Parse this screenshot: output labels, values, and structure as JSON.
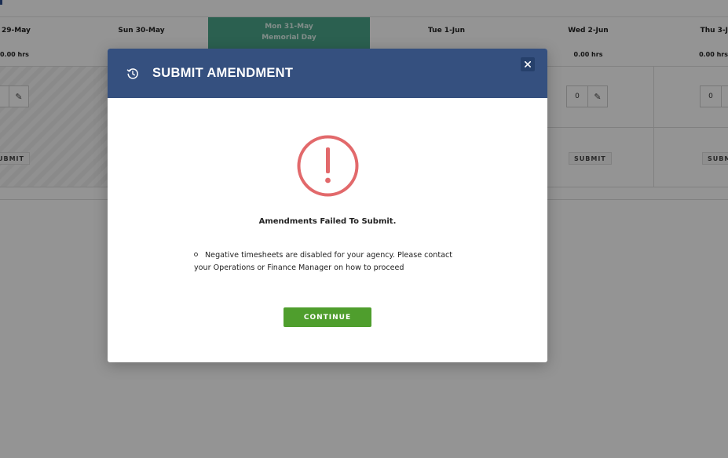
{
  "background": {
    "days": [
      {
        "label": "29-May",
        "hours": "0.00 hrs"
      },
      {
        "label": "Sun 30-May",
        "hours": ""
      },
      {
        "label": "Mon 31-May",
        "sublabel": "Memorial Day",
        "hours": ""
      },
      {
        "label": "Tue 1-Jun",
        "hours": ""
      },
      {
        "label": "Wed 2-Jun",
        "hours": "0.00 hrs"
      },
      {
        "label": "Thu 3-J",
        "hours": "0.00 hrs"
      }
    ],
    "entries": [
      {
        "value": "0"
      },
      {
        "value": "0"
      }
    ],
    "submit_label": "SUBMIT",
    "submit_label_left": "UBMIT",
    "submit_label_right": "SUBM"
  },
  "modal": {
    "title": "SUBMIT AMENDMENT",
    "icon": "history-icon",
    "close_icon": "close-icon",
    "warning_icon": "exclamation-circle-icon",
    "heading": "Amendments Failed To Submit.",
    "message": "Negative timesheets are disabled for your agency. Please contact your Operations or Finance Manager on how to proceed",
    "continue_label": "CONTINUE",
    "colors": {
      "header": "#35507f",
      "warning": "#e2696b",
      "continue": "#4f9e2d"
    }
  }
}
